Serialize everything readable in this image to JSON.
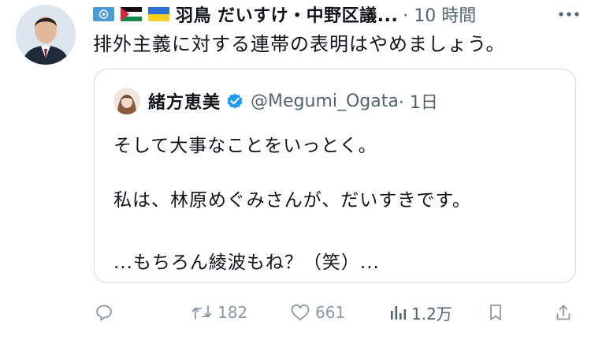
{
  "tweet": {
    "author_name": "羽鳥 だいすけ・中野区議...",
    "time_label": "· 10 時間",
    "text": "排外主義に対する連帯の表明はやめましょう。",
    "flags": [
      "un-flag-icon",
      "palestine-flag-icon",
      "ukraine-flag-icon"
    ]
  },
  "quoted_tweet": {
    "author_name": "緒方恵美",
    "verified": true,
    "handle": "@Megumi_Ogata",
    "time_label": "· 1日",
    "lines": [
      "そして大事なことをいっとく。",
      "私は、林原めぐみさんが、だいすきです。",
      "...もちろん綾波もね？（笑）..."
    ]
  },
  "actions": {
    "reply": "",
    "retweet_count": "182",
    "like_count": "661",
    "views_count": "1.2万"
  },
  "colors": {
    "text": "#0f1419",
    "muted": "#536471",
    "action_gray": "#8b98a5",
    "verified_blue": "#1d9bf0",
    "border": "#cfd9de"
  }
}
